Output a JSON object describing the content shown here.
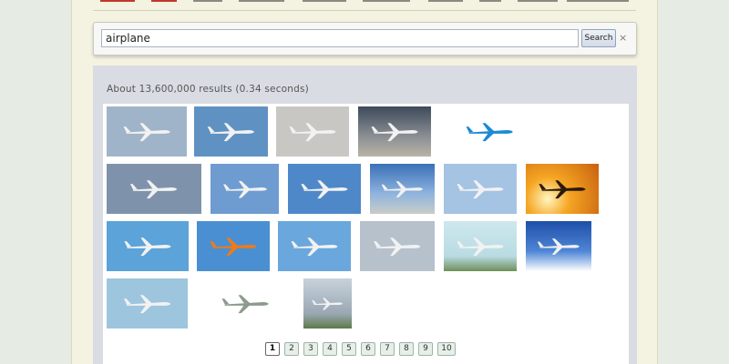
{
  "search": {
    "query": "airplane",
    "button_label": "Search",
    "clear_label": "×"
  },
  "results": {
    "stats": "About 13,600,000 results (0.34 seconds)"
  },
  "thumbnails": [
    {
      "icon": "airliner-landing-photo",
      "sky": "#9fb4c9"
    },
    {
      "icon": "airliner-banking-photo",
      "sky": "#5f92c2"
    },
    {
      "icon": "airliner-overhead-photo",
      "sky": "#c9c7c3"
    },
    {
      "icon": "wrecked-plane-photo",
      "sky": "#6e7680"
    },
    {
      "icon": "klm-airliner-photo",
      "sky": "#ffffff"
    },
    {
      "icon": "airliner-front-photo",
      "sky": "#7e93ab"
    },
    {
      "icon": "airliner-side-photo",
      "sky": "#6f9cd0"
    },
    {
      "icon": "airliner-climbing-photo",
      "sky": "#4f88c8"
    },
    {
      "icon": "airliner-ground-photo",
      "sky": "#5c82b5"
    },
    {
      "icon": "airliner-cloud-photo",
      "sky": "#a5c3e3"
    },
    {
      "icon": "sunset-plane-photo",
      "sky": "#f0a12a"
    },
    {
      "icon": "airliner-below-photo",
      "sky": "#5ba3d8"
    },
    {
      "icon": "orange-airliner-photo",
      "sky": "#4a8fd1"
    },
    {
      "icon": "airliner-overhead-blue-photo",
      "sky": "#69a7dd"
    },
    {
      "icon": "airliner-cruise-photo",
      "sky": "#b6c1cc"
    },
    {
      "icon": "airport-tower-photo",
      "sky": "#b9dbe2"
    },
    {
      "icon": "cartoon-airliner-photo",
      "sky": "#2a5fb8"
    },
    {
      "icon": "airliner-frontal-photo",
      "sky": "#9ec5de"
    },
    {
      "icon": "fighter-jet-drawing-photo",
      "sky": "#ffffff"
    },
    {
      "icon": "airliner-takeoff-photo",
      "sky": "#aab7c3"
    }
  ],
  "pagination": {
    "pages": [
      "1",
      "2",
      "3",
      "4",
      "5",
      "6",
      "7",
      "8",
      "9",
      "10"
    ],
    "current": "1"
  },
  "colors": {
    "accent": "#8fa3be",
    "panel": "#d9dde3",
    "page_bg": "#f4f2e0"
  }
}
